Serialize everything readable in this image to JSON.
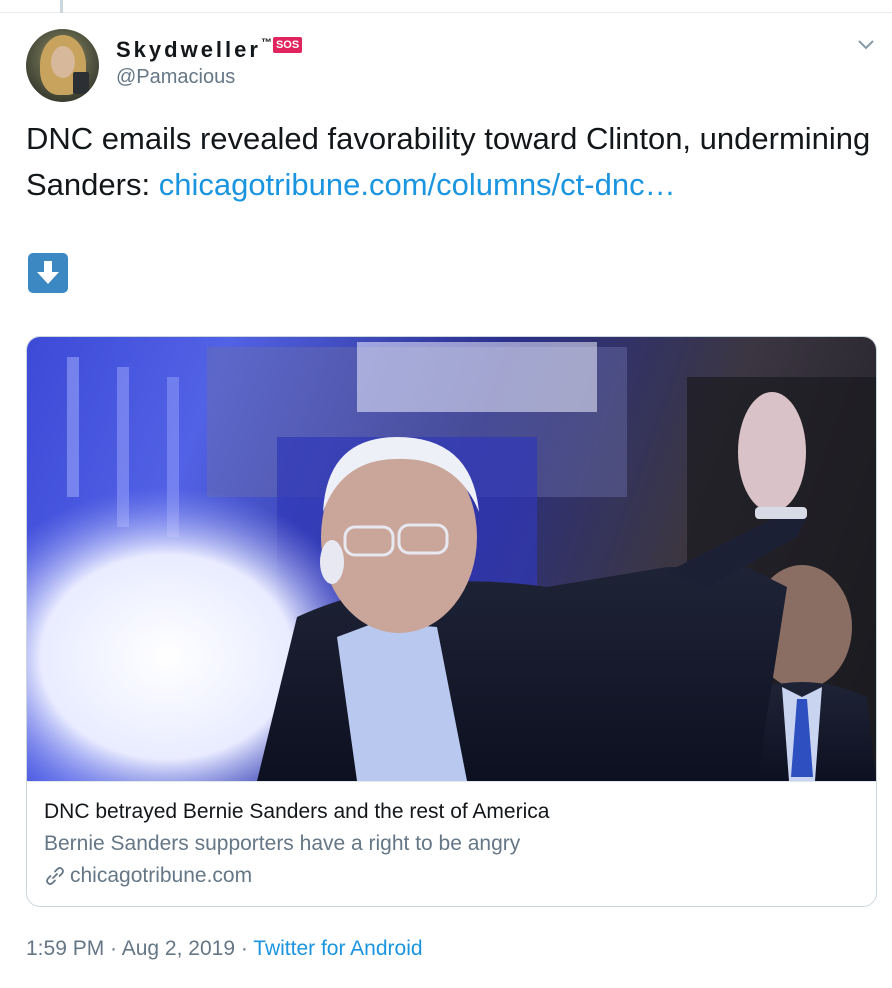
{
  "tweet": {
    "display_name": "Skydweller",
    "trademark": "™",
    "badge": "SOS",
    "handle": "@Pamacious",
    "text_main": "DNC emails revealed favorability toward Clinton, undermining Sanders: ",
    "link_text": "chicagotribune.com/columns/ct-dnc…",
    "emoji": "down-arrow-emoji"
  },
  "card": {
    "title": "DNC betrayed Bernie Sanders and the rest of America",
    "description": "Bernie Sanders supporters have a right to be angry",
    "domain": "chicagotribune.com"
  },
  "meta": {
    "time": "1:59 PM",
    "date": "Aug 2, 2019",
    "separator": " · ",
    "source": "Twitter for Android"
  },
  "colors": {
    "link": "#1b95e0",
    "secondary_text": "#657786",
    "badge": "#e0245e",
    "emoji_blue": "#3b88c3"
  }
}
